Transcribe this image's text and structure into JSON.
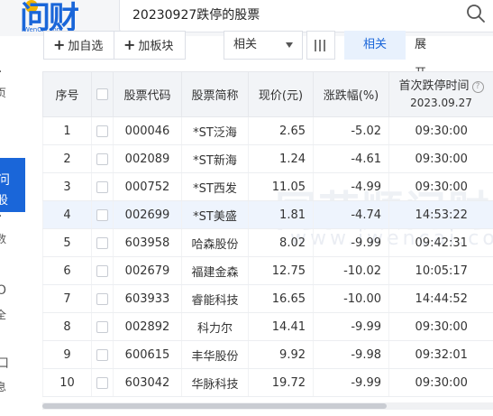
{
  "brand": {
    "logo_text": "问财",
    "logo_sub": "iWenCai.com"
  },
  "search": {
    "query": "20230927跌停的股票"
  },
  "sidebar": {
    "items": [
      {
        "glyph": "·",
        "label": "页"
      },
      {
        "glyph": "问",
        "label": "股"
      },
      {
        "glyph": "·",
        "label": "数"
      },
      {
        "glyph": "O",
        "label": "全"
      },
      {
        "glyph": "口",
        "label": "息"
      }
    ]
  },
  "toolbar": {
    "add_watch_label": "加自选",
    "add_board_label": "加板块",
    "sort_select": "相关",
    "sort_button": "相关",
    "expand_label": "展开"
  },
  "table": {
    "headers": {
      "index": "序号",
      "code": "股票代码",
      "name": "股票简称",
      "price": "现价(元)",
      "change": "涨跌幅(%)",
      "time_title": "首次跌停时间",
      "time_date": "2023.09.27"
    },
    "rows": [
      {
        "index": "1",
        "code": "000046",
        "name": "*ST泛海",
        "price": "2.65",
        "change": "-5.02",
        "time": "09:30:00"
      },
      {
        "index": "2",
        "code": "002089",
        "name": "*ST新海",
        "price": "1.24",
        "change": "-4.61",
        "time": "09:30:00"
      },
      {
        "index": "3",
        "code": "000752",
        "name": "*ST西发",
        "price": "11.05",
        "change": "-4.99",
        "time": "09:30:00"
      },
      {
        "index": "4",
        "code": "002699",
        "name": "*ST美盛",
        "price": "1.81",
        "change": "-4.74",
        "time": "14:53:22"
      },
      {
        "index": "5",
        "code": "603958",
        "name": "哈森股份",
        "price": "8.02",
        "change": "-9.99",
        "time": "09:42:31"
      },
      {
        "index": "6",
        "code": "002679",
        "name": "福建金森",
        "price": "12.75",
        "change": "-10.02",
        "time": "10:05:17"
      },
      {
        "index": "7",
        "code": "603933",
        "name": "睿能科技",
        "price": "16.65",
        "change": "-10.00",
        "time": "14:44:52"
      },
      {
        "index": "8",
        "code": "002892",
        "name": "科力尔",
        "price": "14.41",
        "change": "-9.99",
        "time": "09:30:00"
      },
      {
        "index": "9",
        "code": "600615",
        "name": "丰华股份",
        "price": "9.92",
        "change": "-9.98",
        "time": "09:32:01"
      },
      {
        "index": "10",
        "code": "603042",
        "name": "华脉科技",
        "price": "19.72",
        "change": "-9.99",
        "time": "09:30:00"
      }
    ]
  },
  "watermark": {
    "main": "同花顺问财",
    "sub": "www.iwencai.com"
  },
  "colors": {
    "accent": "#1a66d9",
    "down": "#1d9a42",
    "logo_dot": "#f2b400"
  }
}
